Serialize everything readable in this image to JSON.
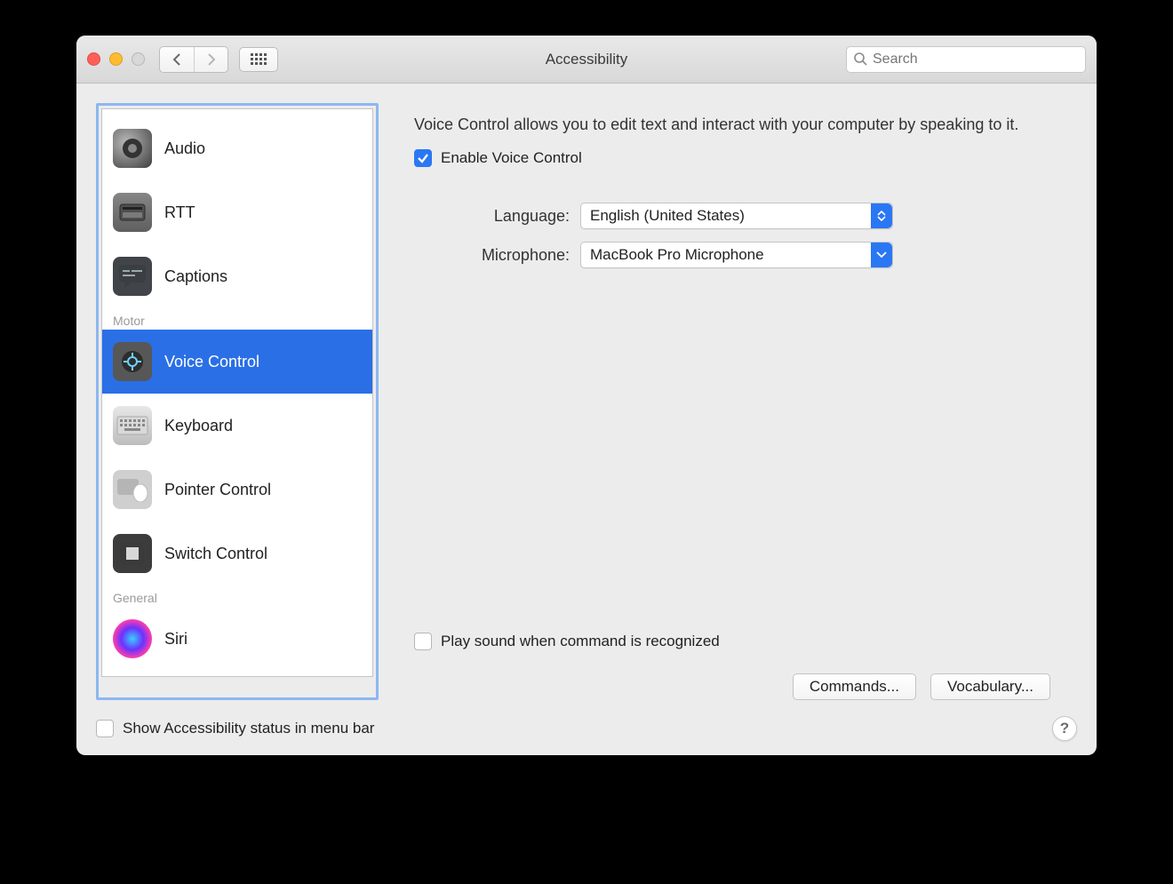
{
  "window": {
    "title": "Accessibility"
  },
  "toolbar": {
    "search_placeholder": "Search"
  },
  "sidebar": {
    "items": [
      {
        "label": "Audio"
      },
      {
        "label": "RTT"
      },
      {
        "label": "Captions"
      }
    ],
    "group_motor": "Motor",
    "motor_items": [
      {
        "label": "Voice Control"
      },
      {
        "label": "Keyboard"
      },
      {
        "label": "Pointer Control"
      },
      {
        "label": "Switch Control"
      }
    ],
    "group_general": "General",
    "general_items": [
      {
        "label": "Siri"
      }
    ]
  },
  "main": {
    "description": "Voice Control allows you to edit text and interact with your computer by speaking to it.",
    "enable_label": "Enable Voice Control",
    "enable_checked": true,
    "language_label": "Language:",
    "language_value": "English (United States)",
    "microphone_label": "Microphone:",
    "microphone_value": "MacBook Pro Microphone",
    "play_sound_label": "Play sound when command is recognized",
    "play_sound_checked": false,
    "commands_button": "Commands...",
    "vocabulary_button": "Vocabulary..."
  },
  "footer": {
    "show_status_label": "Show Accessibility status in menu bar",
    "show_status_checked": false
  }
}
